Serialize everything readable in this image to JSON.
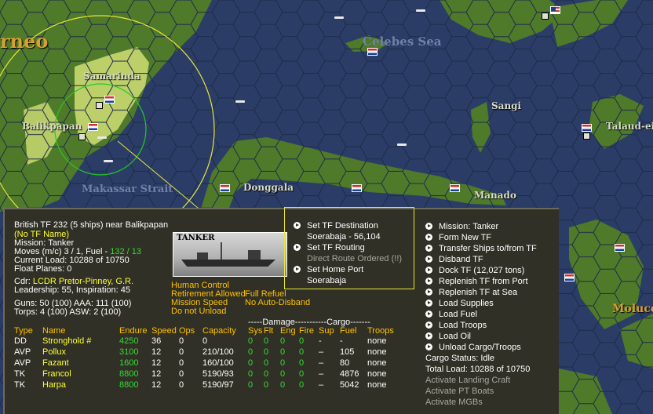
{
  "map": {
    "labels": {
      "borneo": "rneo",
      "celebes_sea": "Celebes Sea",
      "samarinda": "Samarinda",
      "balikpapan": "Balikpapan",
      "makassar": "Makassar Strait",
      "sangi": "Sangi",
      "talaud": "Talaud-eil",
      "donggala": "Donggala",
      "manado": "Manado",
      "moluccas": "Molucca"
    },
    "colors": {
      "sea": "#2b3d66",
      "land": "#4f7a2a",
      "highlight_land": "#c8d870",
      "selection_ring": "#e6e63a",
      "range_ring": "#22cc22"
    }
  },
  "tf": {
    "title": "British TF 232 (5 ships)  near Balikpapan",
    "name_status": "(No TF Name)",
    "mission": "Mission:  Tanker",
    "moves_prefix": "Moves (m/c)  3 / 1, Fuel - ",
    "moves_fuel": "132 / 13",
    "current_load": "Current Load:  10288 of 10750",
    "float_planes": "Float Planes:  0",
    "cdr_label": "Cdr: ",
    "cdr_name": "LCDR  Pretor-Pinney, G.R.",
    "leadership": "Leadership: 55, Inspiration: 45",
    "guns": "Guns: 50 (100)  AAA: 111 (100)",
    "torps": "Torps: 4 (100)  ASW: 2 (100)",
    "ship_type_label": "TANKER"
  },
  "options": {
    "human_control": "Human Control",
    "retirement": "Retirement Allowed",
    "full_refuel": "Full Refuel",
    "mission_speed": "Mission Speed",
    "no_auto_disband": "No Auto-Disband",
    "do_not_unload": "Do not Unload"
  },
  "tf_commands": {
    "set_destination": "Set TF Destination",
    "destination_value": "Soerabaja - 56,104",
    "set_routing": "Set TF Routing",
    "routing_value": "Direct Route Ordered (!!)",
    "set_home_port": "Set Home Port",
    "home_port_value": "Soerabaja"
  },
  "table": {
    "damage_header": "-----Damage-----------Cargo-------",
    "headers": [
      "Type",
      "Name",
      "Endure",
      "Speed",
      "Ops",
      "Capacity",
      "Sys",
      "Flt",
      "Eng",
      "Fire",
      "Sup",
      "Fuel",
      "Troops"
    ],
    "rows": [
      {
        "type": "DD",
        "name": "Stronghold #",
        "endure": "4250",
        "speed": "36",
        "ops": "0",
        "capacity": "0",
        "sys": "0",
        "flt": "0",
        "eng": "0",
        "fire": "0",
        "sup": "-",
        "fuel": "-",
        "troops": "none"
      },
      {
        "type": "AVP",
        "name": "Pollux",
        "endure": "3100",
        "speed": "12",
        "ops": "0",
        "capacity": "210/100",
        "sys": "0",
        "flt": "0",
        "eng": "0",
        "fire": "0",
        "sup": "–",
        "fuel": "105",
        "troops": "none"
      },
      {
        "type": "AVP",
        "name": "Fazant",
        "endure": "1600",
        "speed": "12",
        "ops": "0",
        "capacity": "160/100",
        "sys": "0",
        "flt": "0",
        "eng": "0",
        "fire": "0",
        "sup": "–",
        "fuel": "80",
        "troops": "none"
      },
      {
        "type": "TK",
        "name": "Francol",
        "endure": "8800",
        "speed": "12",
        "ops": "0",
        "capacity": "5190/93",
        "sys": "0",
        "flt": "0",
        "eng": "0",
        "fire": "0",
        "sup": "–",
        "fuel": "4876",
        "troops": "none"
      },
      {
        "type": "TK",
        "name": "Harpa",
        "endure": "8800",
        "speed": "12",
        "ops": "0",
        "capacity": "5190/97",
        "sys": "0",
        "flt": "0",
        "eng": "0",
        "fire": "0",
        "sup": "–",
        "fuel": "5042",
        "troops": "none"
      }
    ]
  },
  "menu": {
    "items": [
      "Mission: Tanker",
      "Form New TF",
      "Transfer Ships to/from TF",
      "Disband TF",
      "Dock TF (12,027 tons)",
      "Replenish TF from Port",
      "Replenish TF at Sea",
      "Load Supplies",
      "Load Fuel",
      "Load Troops",
      "Load Oil",
      "Unload Cargo/Troops"
    ],
    "cargo_status": "Cargo Status: Idle",
    "total_load": "Total Load: 10288 of 10750",
    "disabled": [
      "Activate Landing Craft",
      "Activate PT Boats",
      "Activate MGBs"
    ]
  }
}
